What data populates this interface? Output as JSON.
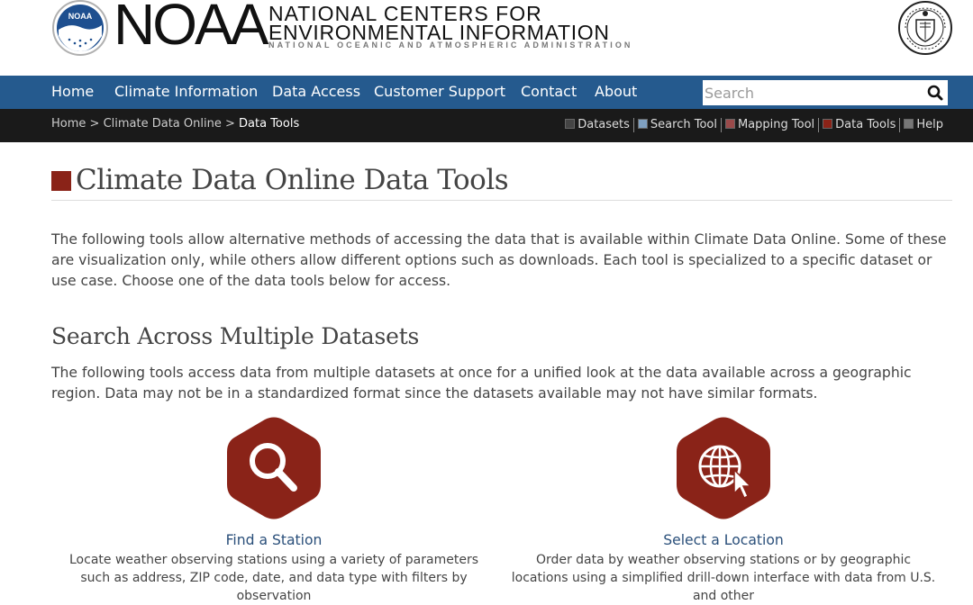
{
  "header": {
    "noaa_wordmark": "NOAA",
    "line1": "NATIONAL CENTERS FOR",
    "line2": "ENVIRONMENTAL INFORMATION",
    "line3": "NATIONAL OCEANIC AND ATMOSPHERIC ADMINISTRATION",
    "noaa_logo_text": "NOAA",
    "seal_icon": "department-of-commerce-seal"
  },
  "nav": {
    "items": [
      "Home",
      "Climate Information",
      "Data Access",
      "Customer Support",
      "Contact",
      "About"
    ],
    "search_placeholder": "Search",
    "search_icon": "search-icon"
  },
  "subnav": {
    "breadcrumb": [
      "Home",
      "Climate Data Online",
      "Data Tools"
    ],
    "separator": ">",
    "tools": [
      {
        "label": "Datasets",
        "color": "#444444"
      },
      {
        "label": "Search Tool",
        "color": "#7fa0c0"
      },
      {
        "label": "Mapping Tool",
        "color": "#9a4a4a"
      },
      {
        "label": "Data Tools",
        "color": "#8a2318"
      },
      {
        "label": "Help",
        "color": "#777777"
      }
    ]
  },
  "main": {
    "title": "Climate Data Online Data Tools",
    "intro": "The following tools allow alternative methods of accessing the data that is available within Climate Data Online. Some of these are visualization only, while others allow different options such as downloads. Each tool is specialized to a specific dataset or use case. Choose one of the data tools below for access.",
    "section_title": "Search Across Multiple Datasets",
    "section_desc": "The following tools access data from multiple datasets at once for a unified look at the data available across a geographic region. Data may not be in a standardized format since the datasets available may not have similar formats.",
    "cards": [
      {
        "title": "Find a Station",
        "desc": "Locate weather observing stations using a variety of parameters such as address, ZIP code, date, and data type with filters by observation",
        "icon": "magnifier-icon"
      },
      {
        "title": "Select a Location",
        "desc": "Order data by weather observing stations or by geographic locations using a simplified drill-down interface with data from U.S. and other",
        "icon": "globe-cursor-icon"
      }
    ]
  },
  "colors": {
    "nav_blue": "#255a8e",
    "subnav_black": "#1a1a1a",
    "accent_red": "#8a2318"
  }
}
